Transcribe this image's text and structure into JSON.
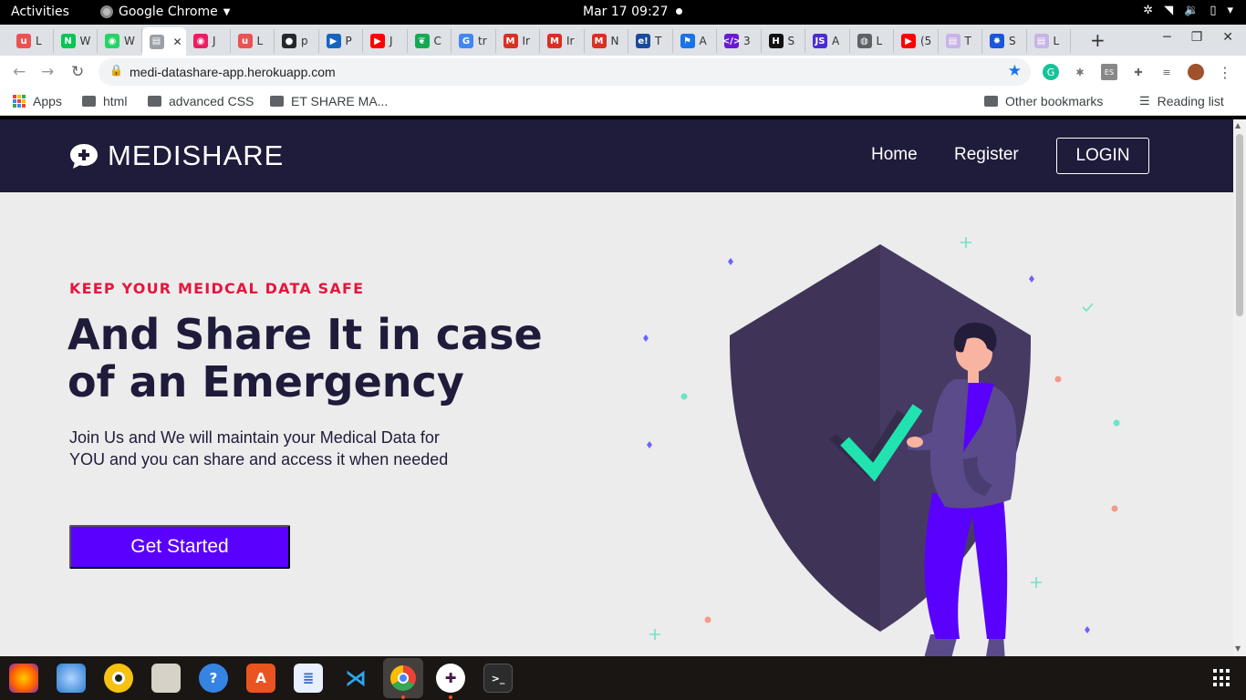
{
  "system_bar": {
    "activities": "Activities",
    "app_name": "Google Chrome",
    "clock": "Mar 17  09:27"
  },
  "browser": {
    "tabs": [
      {
        "label": "L",
        "icon": "udemy-icon",
        "color": "#ec5252"
      },
      {
        "label": "W",
        "icon": "notion-n-icon",
        "color": "#00c853"
      },
      {
        "label": "W",
        "icon": "whatsapp-icon",
        "color": "#25d366"
      },
      {
        "label": "",
        "icon": "page-icon",
        "color": "#9aa0a6",
        "active": true
      },
      {
        "label": "J",
        "icon": "podcast-icon",
        "color": "#e91e63"
      },
      {
        "label": "L",
        "icon": "udemy-icon",
        "color": "#ec5252"
      },
      {
        "label": "p",
        "icon": "github-icon",
        "color": "#24292e"
      },
      {
        "label": "P",
        "icon": "play-icon",
        "color": "#1565c0"
      },
      {
        "label": "J",
        "icon": "youtube-icon",
        "color": "#ff0000"
      },
      {
        "label": "C",
        "icon": "mongodb-leaf-icon",
        "color": "#13aa52"
      },
      {
        "label": "tr",
        "icon": "google-icon",
        "color": "#4285f4"
      },
      {
        "label": "Ir",
        "icon": "gmail-icon",
        "color": "#d93025"
      },
      {
        "label": "Ir",
        "icon": "gmail-icon",
        "color": "#d93025"
      },
      {
        "label": "N",
        "icon": "gmail-icon",
        "color": "#d93025"
      },
      {
        "label": "T",
        "icon": "e-icon",
        "color": "#1a4a9c"
      },
      {
        "label": "A",
        "icon": "flag-icon",
        "color": "#1a73e8"
      },
      {
        "label": "3",
        "icon": "code-icon",
        "color": "#6a1bd1"
      },
      {
        "label": "S",
        "icon": "hackerrank-icon",
        "color": "#111111"
      },
      {
        "label": "A",
        "icon": "js-icon",
        "color": "#4b2bd6"
      },
      {
        "label": "L",
        "icon": "globe-icon",
        "color": "#5f6368"
      },
      {
        "label": "(5",
        "icon": "youtube-icon",
        "color": "#ff0000"
      },
      {
        "label": "T",
        "icon": "page-icon",
        "color": "#c8b4e6"
      },
      {
        "label": "S",
        "icon": "gear-icon",
        "color": "#1a56db"
      },
      {
        "label": "L",
        "icon": "page-icon",
        "color": "#c8b4e6"
      }
    ],
    "address": "medi-datashare-app.herokuapp.com",
    "bookmarks": {
      "apps": "Apps",
      "items": [
        "html",
        "advanced CSS",
        "ET SHARE MA..."
      ],
      "other": "Other bookmarks",
      "reading_list": "Reading list"
    }
  },
  "site": {
    "brand": "MEDISHARE",
    "nav": {
      "home": "Home",
      "register": "Register",
      "login": "LOGIN"
    },
    "hero": {
      "kicker": "KEEP YOUR MEIDCAL DATA SAFE",
      "headline": "And Share It in case of an Emergency",
      "lead": "Join Us and We will maintain your Medical Data for YOU and you can share and access it when needed",
      "cta": "Get Started"
    },
    "colors": {
      "header_bg": "#1f1b3a",
      "accent_red": "#e5163d",
      "cta_purple": "#5a00ff",
      "page_bg": "#ececec"
    }
  },
  "dock": {
    "apps": [
      "firefox-icon",
      "thunderbird-icon",
      "rhythmbox-icon",
      "files-icon",
      "help-icon",
      "software-center-icon",
      "text-editor-icon",
      "vscode-icon",
      "chrome-icon",
      "slack-icon",
      "terminal-icon"
    ]
  }
}
